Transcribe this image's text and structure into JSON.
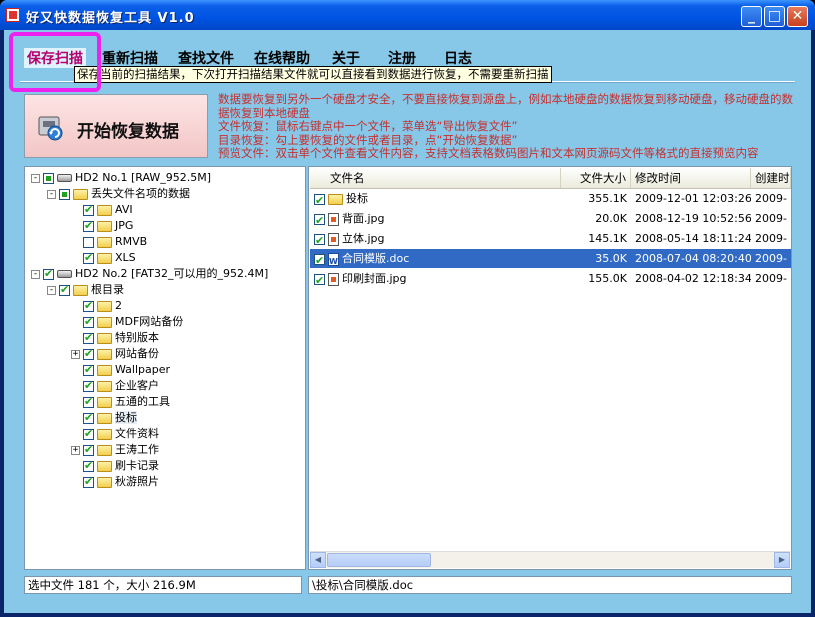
{
  "window": {
    "title": "好又快数据恢复工具 V1.0"
  },
  "titlebar_buttons": {
    "minimize": "_",
    "maximize": "□",
    "close": "✕"
  },
  "menu": {
    "items": [
      {
        "label": "保存扫描",
        "active": true
      },
      {
        "label": "重新扫描"
      },
      {
        "label": "查找文件"
      },
      {
        "label": "在线帮助"
      },
      {
        "label": "关于"
      },
      {
        "label": "注册"
      },
      {
        "label": "日志"
      }
    ],
    "tooltip": "保存当前的扫描结果，下次打开扫描结果文件就可以直接看到数据进行恢复，不需要重新扫描"
  },
  "start_button": {
    "label": "开始恢复数据"
  },
  "info": {
    "lines": [
      "数据要恢复到另外一个硬盘才安全，不要直接恢复到源盘上，例如本地硬盘的数据恢复到移动硬盘，移动硬盘的数据恢复到本地硬盘",
      "文件恢复：鼠标右键点中一个文件，菜单选“导出恢复文件”",
      "目录恢复：勾上要恢复的文件或者目录，点“开始恢复数据”",
      "预览文件：双击单个文件查看文件内容，支持文档表格数码图片和文本网页源码文件等格式的直接预览内容"
    ]
  },
  "tree": {
    "nodes": [
      {
        "label": "HD2 No.1 [RAW_952.5M]",
        "type": "drive",
        "check": "partial",
        "expander": "-",
        "level": 0
      },
      {
        "label": "丢失文件名项的数据",
        "type": "folder",
        "check": "partial",
        "expander": "-",
        "level": 1
      },
      {
        "label": "AVI",
        "type": "folder",
        "check": "checked",
        "level": 2
      },
      {
        "label": "JPG",
        "type": "folder",
        "check": "checked",
        "level": 2
      },
      {
        "label": "RMVB",
        "type": "folder",
        "check": "unchecked",
        "level": 2
      },
      {
        "label": "XLS",
        "type": "folder",
        "check": "checked",
        "level": 2
      },
      {
        "label": "HD2 No.2 [FAT32_可以用的_952.4M]",
        "type": "drive",
        "check": "checked",
        "expander": "-",
        "level": 0
      },
      {
        "label": "根目录",
        "type": "folder",
        "check": "checked",
        "expander": "-",
        "level": 1
      },
      {
        "label": "2",
        "type": "folder",
        "check": "checked",
        "level": 2
      },
      {
        "label": "MDF网站备份",
        "type": "folder",
        "check": "checked",
        "level": 2
      },
      {
        "label": "特别版本",
        "type": "folder",
        "check": "checked",
        "level": 2
      },
      {
        "label": "网站备份",
        "type": "folder",
        "check": "checked",
        "expander": "+",
        "level": 2
      },
      {
        "label": "Wallpaper",
        "type": "folder",
        "check": "checked",
        "level": 2
      },
      {
        "label": "企业客户",
        "type": "folder",
        "check": "checked",
        "level": 2
      },
      {
        "label": "五通的工具",
        "type": "folder",
        "check": "checked",
        "level": 2
      },
      {
        "label": "投标",
        "type": "folder",
        "check": "checked",
        "level": 2,
        "selected": true
      },
      {
        "label": "文件资料",
        "type": "folder",
        "check": "checked",
        "level": 2
      },
      {
        "label": "王涛工作",
        "type": "folder",
        "check": "checked",
        "expander": "+",
        "level": 2
      },
      {
        "label": "刷卡记录",
        "type": "folder",
        "check": "checked",
        "level": 2
      },
      {
        "label": "秋游照片",
        "type": "folder",
        "check": "checked",
        "level": 2
      }
    ]
  },
  "file_list": {
    "columns": [
      "文件名",
      "文件大小",
      "修改时间",
      "创建时"
    ],
    "rows": [
      {
        "name": "投标",
        "kind": "folder",
        "size": "355.1K",
        "mtime": "2009-12-01 12:03:26",
        "ctime": "2009-",
        "selected": false
      },
      {
        "name": "背面.jpg",
        "kind": "jpg",
        "size": "20.0K",
        "mtime": "2008-12-19 10:52:56",
        "ctime": "2009-",
        "selected": false
      },
      {
        "name": "立体.jpg",
        "kind": "jpg",
        "size": "145.1K",
        "mtime": "2008-05-14 18:11:24",
        "ctime": "2009-",
        "selected": false
      },
      {
        "name": "合同模版.doc",
        "kind": "doc",
        "size": "35.0K",
        "mtime": "2008-07-04 08:20:40",
        "ctime": "2009-",
        "selected": true
      },
      {
        "name": "印刷封面.jpg",
        "kind": "jpg",
        "size": "155.0K",
        "mtime": "2008-04-02 12:18:34",
        "ctime": "2009-",
        "selected": false
      }
    ]
  },
  "status": {
    "left": "选中文件 181 个，大小 216.9M",
    "right": "\\投标\\合同模版.doc"
  },
  "colors": {
    "accent_highlight": "#ee22ee",
    "info_text": "#c52f2f",
    "selection": "#316ac5",
    "background": "#87c8e8"
  }
}
